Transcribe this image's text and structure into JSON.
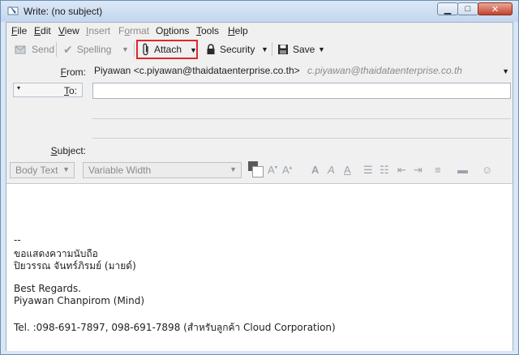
{
  "window": {
    "title": "Write: (no subject)"
  },
  "menu": {
    "items": [
      {
        "label": "File",
        "access": "F",
        "rest": "ile"
      },
      {
        "label": "Edit",
        "access": "E",
        "rest": "dit"
      },
      {
        "label": "View",
        "access": "V",
        "rest": "iew"
      },
      {
        "label": "Insert",
        "access": "I",
        "rest": "nsert"
      },
      {
        "label": "Format",
        "access": "o",
        "pre": "F",
        "rest": "rmat"
      },
      {
        "label": "Options",
        "access": "p",
        "pre": "O",
        "rest": "tions"
      },
      {
        "label": "Tools",
        "access": "T",
        "rest": "ools"
      },
      {
        "label": "Help",
        "access": "H",
        "rest": "elp"
      }
    ]
  },
  "toolbar": {
    "send": "Send",
    "spelling": "Spelling",
    "attach": "Attach",
    "security": "Security",
    "save": "Save"
  },
  "headers": {
    "from_label": "From:",
    "from_value": "Piyawan <c.piyawan@thaidataenterprise.co.th>",
    "from_hint": "c.piyawan@thaidataenterprise.co.th",
    "to_label": "To:",
    "to_value": "",
    "subject_label": "Subject:",
    "subject_value": ""
  },
  "format": {
    "paragraph_style": "Body Text",
    "font": "Variable Width"
  },
  "body": {
    "lines": [
      "--",
      "ขอแสดงความนับถือ",
      "ปิยวรรณ จันทร์ภิรมย์ (มายด์)",
      "Best Regards.",
      "Piyawan Chanpirom (Mind)",
      "Tel. :098-691-7897, 098-691-7898 (สำหรับลูกค้า Cloud Corporation)"
    ]
  },
  "colors": {
    "highlight": "#e0262a",
    "window_frame": "#d9e6f5",
    "close_button": "#c2432d"
  },
  "icons": [
    "app-icon",
    "minimize-icon",
    "maximize-icon",
    "close-icon",
    "send-icon",
    "spelling-check-icon",
    "paperclip-icon",
    "lock-icon",
    "floppy-disk-icon",
    "dropdown-arrow-icon"
  ]
}
